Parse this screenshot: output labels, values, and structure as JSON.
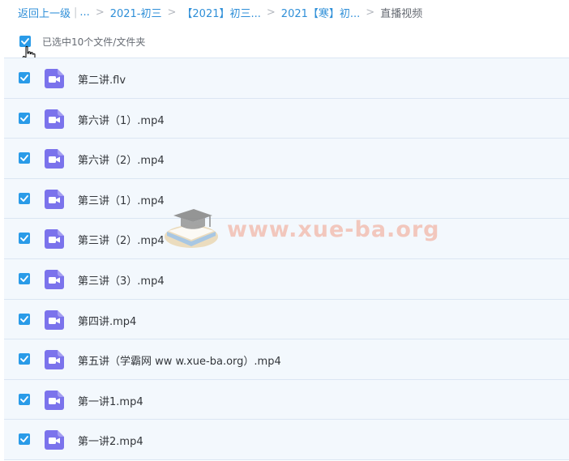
{
  "breadcrumb": {
    "back": "返回上一级",
    "divider": "|",
    "ellipsis": "...",
    "sep": ">",
    "items": [
      "2021-初三",
      "【2021】初三...",
      "2021【寒】初..."
    ],
    "current": "直播视频"
  },
  "selection": {
    "label": "已选中10个文件/文件夹",
    "all_checked": true
  },
  "files": [
    {
      "name": "第二讲.flv",
      "checked": true,
      "icon": "video-file-icon"
    },
    {
      "name": "第六讲（1）.mp4",
      "checked": true,
      "icon": "video-file-icon"
    },
    {
      "name": "第六讲（2）.mp4",
      "checked": true,
      "icon": "video-file-icon"
    },
    {
      "name": "第三讲（1）.mp4",
      "checked": true,
      "icon": "video-file-icon"
    },
    {
      "name": "第三讲（2）.mp4",
      "checked": true,
      "icon": "video-file-icon"
    },
    {
      "name": "第三讲（3）.mp4",
      "checked": true,
      "icon": "video-file-icon"
    },
    {
      "name": "第四讲.mp4",
      "checked": true,
      "icon": "video-file-icon"
    },
    {
      "name": "第五讲（学霸网 ww w.xue-ba.org）.mp4",
      "checked": true,
      "icon": "video-file-icon"
    },
    {
      "name": "第一讲1.mp4",
      "checked": true,
      "icon": "video-file-icon"
    },
    {
      "name": "第一讲2.mp4",
      "checked": true,
      "icon": "video-file-icon"
    }
  ],
  "watermark": {
    "text": "www.xue-ba.org"
  },
  "colors": {
    "accent": "#2a9be8",
    "link": "#2f8fd8",
    "row_bg": "#f3f8fd",
    "video_icon": "#7b73ec"
  }
}
